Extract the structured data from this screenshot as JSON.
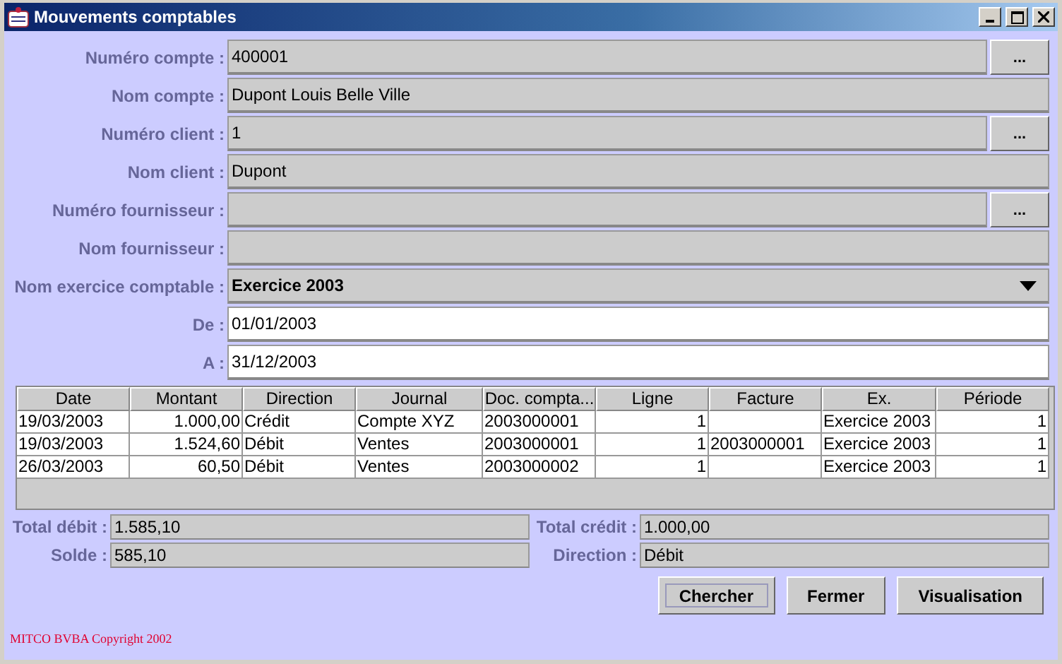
{
  "window": {
    "title": "Mouvements comptables",
    "controls": [
      {
        "kind": "minimize"
      },
      {
        "kind": "maximize"
      },
      {
        "kind": "close"
      }
    ]
  },
  "fields": [
    {
      "label": "Numéro compte :",
      "value": "400001",
      "kind": "lookup",
      "button": "..."
    },
    {
      "label": "Nom compte :",
      "value": "Dupont Louis Belle Ville",
      "kind": "text"
    },
    {
      "label": "Numéro client :",
      "value": "1",
      "kind": "lookup",
      "button": "..."
    },
    {
      "label": "Nom client :",
      "value": "Dupont",
      "kind": "text"
    },
    {
      "label": "Numéro fournisseur :",
      "kind": "lookup",
      "button": "..."
    },
    {
      "label": "Nom fournisseur :",
      "kind": "text"
    },
    {
      "label": "Nom exercice comptable :",
      "value": "Exercice 2003",
      "kind": "combo"
    },
    {
      "label": "De :",
      "value": "01/01/2003",
      "kind": "input"
    },
    {
      "label": "A :",
      "value": "31/12/2003",
      "kind": "input"
    }
  ],
  "table": {
    "columns": [
      "Date",
      "Montant",
      "Direction",
      "Journal",
      "Doc. compta...",
      "Ligne",
      "Facture",
      "Ex.",
      "Période"
    ],
    "rows": [
      [
        "19/03/2003",
        "1.000,00",
        "Crédit",
        "Compte XYZ",
        "2003000001",
        "1",
        "",
        "Exercice 2003",
        "1"
      ],
      [
        "19/03/2003",
        "1.524,60",
        "Débit",
        "Ventes",
        "2003000001",
        "1",
        "2003000001",
        "Exercice 2003",
        "1"
      ],
      [
        "26/03/2003",
        "60,50",
        "Débit",
        "Ventes",
        "2003000002",
        "1",
        "",
        "Exercice 2003",
        "1"
      ]
    ]
  },
  "totals": [
    {
      "label": "Total débit :",
      "value": "1.585,10"
    },
    {
      "label": "Total crédit :",
      "value": "1.000,00"
    },
    {
      "label": "Solde :",
      "value": "585,10"
    },
    {
      "label": "Direction :",
      "value": "Débit"
    }
  ],
  "buttons": [
    {
      "label": "Chercher",
      "focused": true
    },
    {
      "label": "Fermer",
      "focused": false
    },
    {
      "label": "Visualisation",
      "focused": false
    }
  ],
  "copyright": "MITCO BVBA Copyright 2002"
}
